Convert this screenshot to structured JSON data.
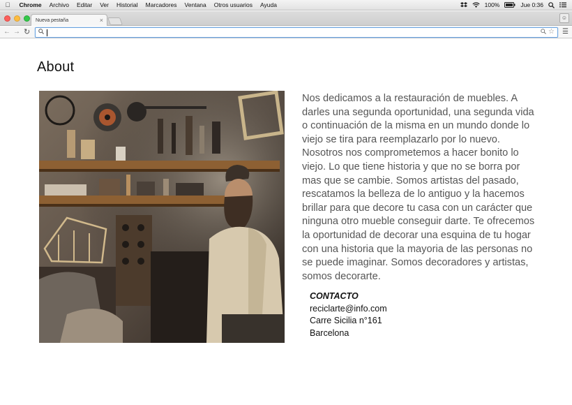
{
  "menubar": {
    "app": "Chrome",
    "items": [
      "Archivo",
      "Editar",
      "Ver",
      "Historial",
      "Marcadores",
      "Ventana",
      "Otros usuarios",
      "Ayuda"
    ],
    "battery": "100%",
    "clock": "Jue 0:36"
  },
  "browser": {
    "tab_title": "Nueva pestaña",
    "address_value": ""
  },
  "page": {
    "title": "About",
    "body": "Nos dedicamos a la restauración de muebles. A darles una segunda oportunidad, una segunda vida o continuación de la misma en un mundo donde lo viejo se tira para reemplazarlo por lo nuevo. Nosotros nos comprometemos a hacer bonito lo viejo. Lo que tiene historia y que no se borra por mas que se cambie. Somos artistas del pasado, rescatamos la belleza de lo antiguo y la hacemos brillar para que decore tu casa con un carácter que ninguna otro mueble conseguir darte. Te ofrecemos la oportunidad de decorar una esquina de tu hogar con una historia que la mayoria de las personas no se puede imaginar. Somos decoradores y artistas, somos decorarte.",
    "contact": {
      "heading": "CONTACTO",
      "email": "reciclarte@info.com",
      "street": "Carre Sicilia n°161",
      "city": "Barcelona"
    }
  },
  "colors": {
    "close": "#fc605c",
    "minimize": "#fdbc40",
    "zoom": "#34c84a",
    "focus_ring": "#6aa3e0"
  },
  "icons": [
    "apple-icon",
    "dropbox-icon",
    "wifi-icon",
    "battery-icon",
    "search-icon",
    "list-icon",
    "close-icon",
    "back-icon",
    "forward-icon",
    "reload-icon",
    "zoom-icon",
    "star-icon",
    "menu-icon",
    "user-icon"
  ]
}
